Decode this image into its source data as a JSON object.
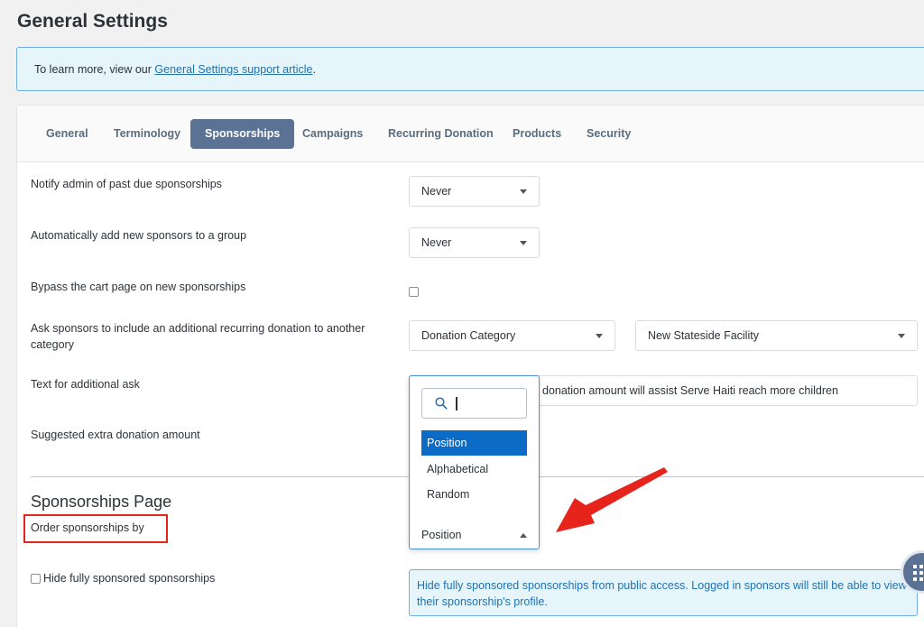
{
  "page": {
    "title": "General Settings"
  },
  "notice": {
    "prefix": "To learn more, view our ",
    "link": "General Settings support article",
    "suffix": "."
  },
  "tabs": [
    {
      "label": "General",
      "active": false
    },
    {
      "label": "Terminology",
      "active": false
    },
    {
      "label": "Sponsorships",
      "active": true
    },
    {
      "label": "Campaigns",
      "active": false
    },
    {
      "label": "Recurring Donation",
      "active": false
    },
    {
      "label": "Products",
      "active": false
    },
    {
      "label": "Security",
      "active": false
    }
  ],
  "settings": {
    "notify_admin": {
      "label": "Notify admin of past due sponsorships",
      "value": "Never"
    },
    "auto_group": {
      "label": "Automatically add new sponsors to a group",
      "value": "Never"
    },
    "bypass_cart": {
      "label": "Bypass the cart page on new sponsorships",
      "checked": false
    },
    "additional_ask": {
      "label": "Ask sponsors to include an additional recurring donation to another category",
      "category_value": "Donation Category",
      "facility_value": "New Stateside Facility"
    },
    "ask_text": {
      "label": "Text for additional ask",
      "value": "donation amount will assist Serve Haiti reach more children"
    },
    "extra_amount": {
      "label": "Suggested extra donation amount"
    }
  },
  "sponsorships_page": {
    "title": "Sponsorships Page",
    "order_by": {
      "label": "Order sponsorships by",
      "value": "Position",
      "search_value": "",
      "options": [
        "Position",
        "Alphabetical",
        "Random"
      ],
      "selected_option": "Position"
    },
    "hide_fully": {
      "label": "Hide fully sponsored sponsorships",
      "checked": false,
      "info": "Hide fully sponsored sponsorships from public access. Logged in sponsors will still be able to view their sponsorship's profile."
    }
  },
  "colors": {
    "accent": "#5b7294",
    "selected_option": "#0b6bc6",
    "annotation_red": "#e6241b",
    "info_background": "#e5f5fa"
  }
}
